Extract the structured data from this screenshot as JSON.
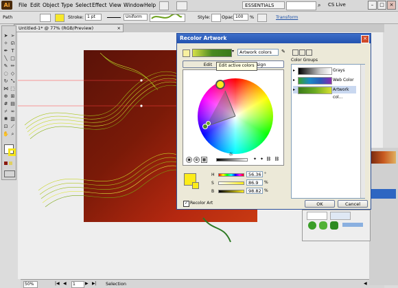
{
  "menubar": {
    "items": [
      "File",
      "Edit",
      "Object",
      "Type",
      "Select",
      "Effect",
      "View",
      "Window",
      "Help"
    ],
    "workspace": "ESSENTIALS",
    "cslive": "CS Live"
  },
  "control": {
    "selection": "Path",
    "stroke_label": "Stroke:",
    "stroke_weight": "1 pt",
    "uniform": "Uniform",
    "style_label": "Style:",
    "opacity_label": "Opacity:",
    "opacity_value": "100",
    "opacity_unit": "%",
    "transform": "Transform"
  },
  "document": {
    "tab": "Untitled-1* @ 77% (RGB/Preview)"
  },
  "status": {
    "zoom": "50%",
    "page": "1",
    "mode": "Selection"
  },
  "dialog": {
    "title": "Recolor Artwork",
    "preset_name": "Artwork colors",
    "tabs": [
      "Edit",
      "Assign"
    ],
    "tooltip": "Edit active colors",
    "color_groups_label": "Color Groups",
    "groups": [
      {
        "name": "Grays"
      },
      {
        "name": "Web Color ..."
      },
      {
        "name": "Artwork col..."
      }
    ],
    "hsb": [
      {
        "label": "H",
        "value": "56.36",
        "unit": "°"
      },
      {
        "label": "S",
        "value": "86.9",
        "unit": "%"
      },
      {
        "label": "B",
        "value": "98.82",
        "unit": "%"
      }
    ],
    "recolor_label": "Recolor Art",
    "ok": "OK",
    "cancel": "Cancel"
  },
  "colors": {
    "accent": "#2453b0",
    "active_color": "#fcec1a"
  }
}
